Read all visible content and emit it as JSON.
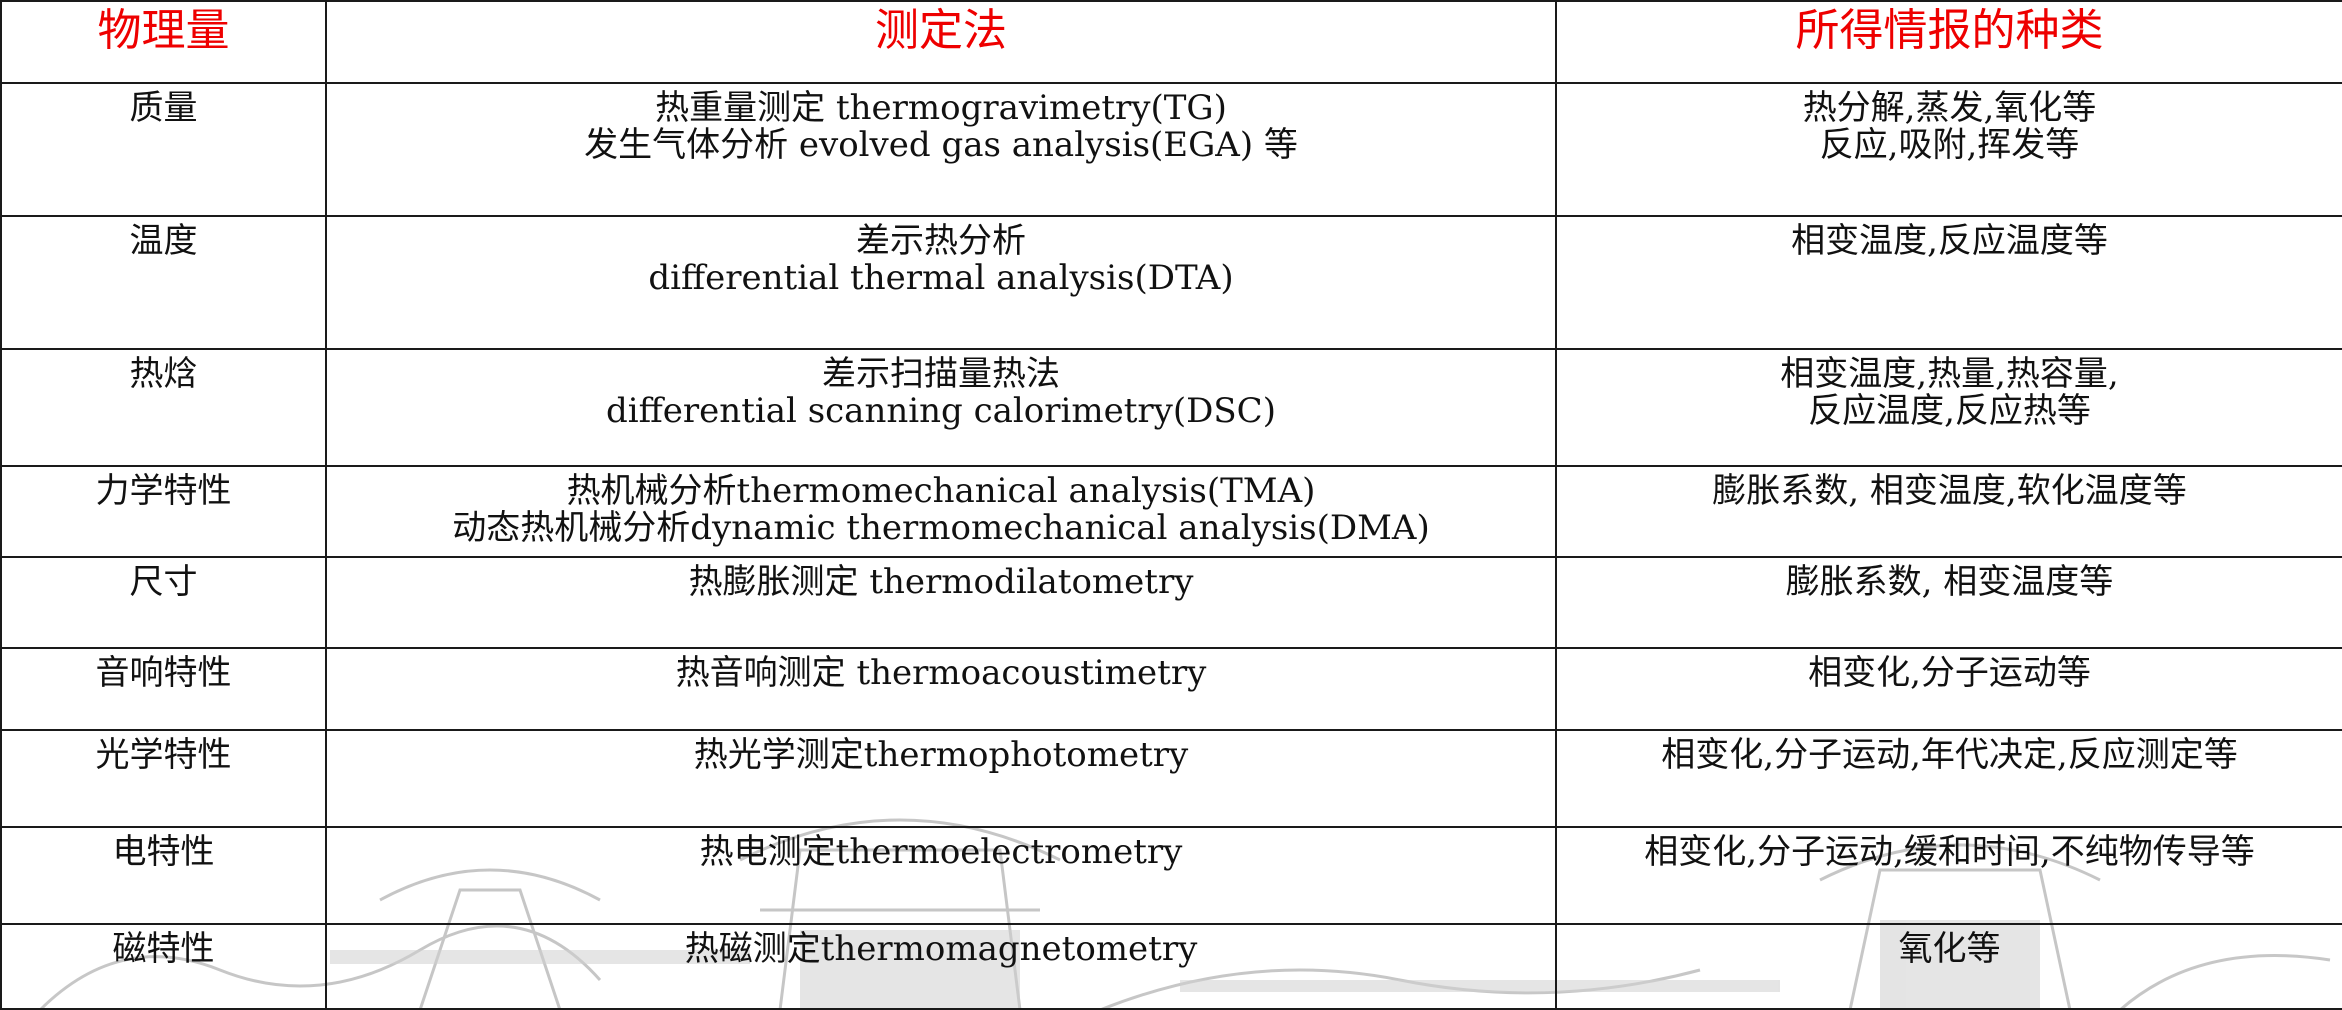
{
  "table": {
    "headers": [
      "物理量",
      "测定法",
      "所得情报的种类"
    ],
    "rows": [
      {
        "quantity": "质量",
        "method": [
          "热重量测定 thermogravimetry(TG)",
          "发生气体分析 evolved gas analysis(EGA) 等"
        ],
        "info": [
          "热分解,蒸发,氧化等",
          "反应,吸附,挥发等"
        ]
      },
      {
        "quantity": "温度",
        "method": [
          "差示热分析",
          "differential thermal analysis(DTA)"
        ],
        "info": [
          "相变温度,反应温度等"
        ]
      },
      {
        "quantity": "热焓",
        "method": [
          "差示扫描量热法",
          "differential scanning calorimetry(DSC)"
        ],
        "info": [
          "相变温度,热量,热容量,",
          "反应温度,反应热等"
        ]
      },
      {
        "quantity": "力学特性",
        "method": [
          "热机械分析thermomechanical analysis(TMA)",
          "动态热机械分析dynamic thermomechanical analysis(DMA)"
        ],
        "info": [
          "膨胀系数, 相变温度,软化温度等"
        ]
      },
      {
        "quantity": "尺寸",
        "method": [
          "热膨胀测定 thermodilatometry"
        ],
        "info": [
          "膨胀系数, 相变温度等"
        ]
      },
      {
        "quantity": "音响特性",
        "method": [
          "热音响测定 thermoacoustimetry"
        ],
        "info": [
          "相变化,分子运动等"
        ]
      },
      {
        "quantity": "光学特性",
        "method": [
          "热光学测定thermophotometry"
        ],
        "info": [
          "相变化,分子运动,年代决定,反应测定等"
        ]
      },
      {
        "quantity": "电特性",
        "method": [
          "热电测定thermoelectrometry"
        ],
        "info": [
          "相变化,分子运动,缓和时间,不纯物传导等"
        ]
      },
      {
        "quantity": "磁特性",
        "method": [
          "热磁测定thermomagnetometry"
        ],
        "info": [
          "氧化等"
        ]
      }
    ]
  },
  "colors": {
    "header_text": "#ee0000",
    "body_text": "#111111",
    "grid": "#1a1a1a",
    "background_art": "#c8c8c8"
  }
}
